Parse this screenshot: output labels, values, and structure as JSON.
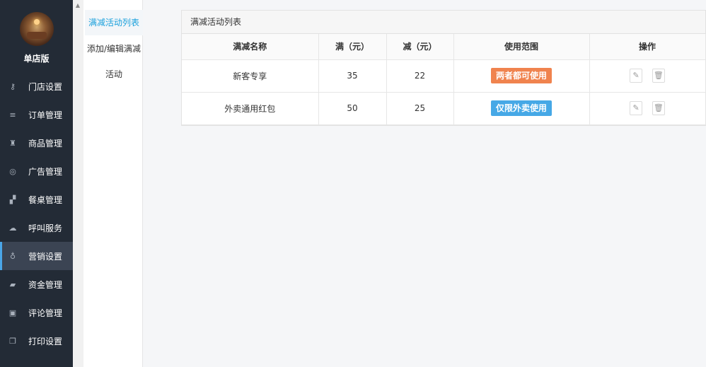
{
  "sidebar": {
    "store_name": "单店版",
    "items": [
      {
        "label": "门店设置",
        "icon": "key-icon",
        "glyph": "⚷"
      },
      {
        "label": "订单管理",
        "icon": "list-icon",
        "glyph": "≡"
      },
      {
        "label": "商品管理",
        "icon": "trophy-icon",
        "glyph": "♜"
      },
      {
        "label": "广告管理",
        "icon": "lifebuoy-icon",
        "glyph": "◎"
      },
      {
        "label": "餐桌管理",
        "icon": "binoculars-icon",
        "glyph": "▞"
      },
      {
        "label": "呼叫服务",
        "icon": "cloud-icon",
        "glyph": "☁"
      },
      {
        "label": "营销设置",
        "icon": "gift-icon",
        "glyph": "♁"
      },
      {
        "label": "资金管理",
        "icon": "book-icon",
        "glyph": "▰"
      },
      {
        "label": "评论管理",
        "icon": "money-icon",
        "glyph": "▣"
      },
      {
        "label": "打印设置",
        "icon": "copy-icon",
        "glyph": "❐"
      }
    ],
    "active_index": 6
  },
  "subnav": {
    "items": [
      "满减活动列表",
      "添加/编辑满减",
      "活动"
    ]
  },
  "panel": {
    "title": "满减活动列表",
    "columns": [
      "满减名称",
      "满（元）",
      "减（元）",
      "使用范围",
      "操作"
    ],
    "rows": [
      {
        "name": "新客专享",
        "full": "35",
        "reduce": "22",
        "scope": "两者都可使用",
        "scope_color": "#f0834e"
      },
      {
        "name": "外卖通用红包",
        "full": "50",
        "reduce": "25",
        "scope": "仅限外卖使用",
        "scope_color": "#46a8e6"
      }
    ]
  }
}
